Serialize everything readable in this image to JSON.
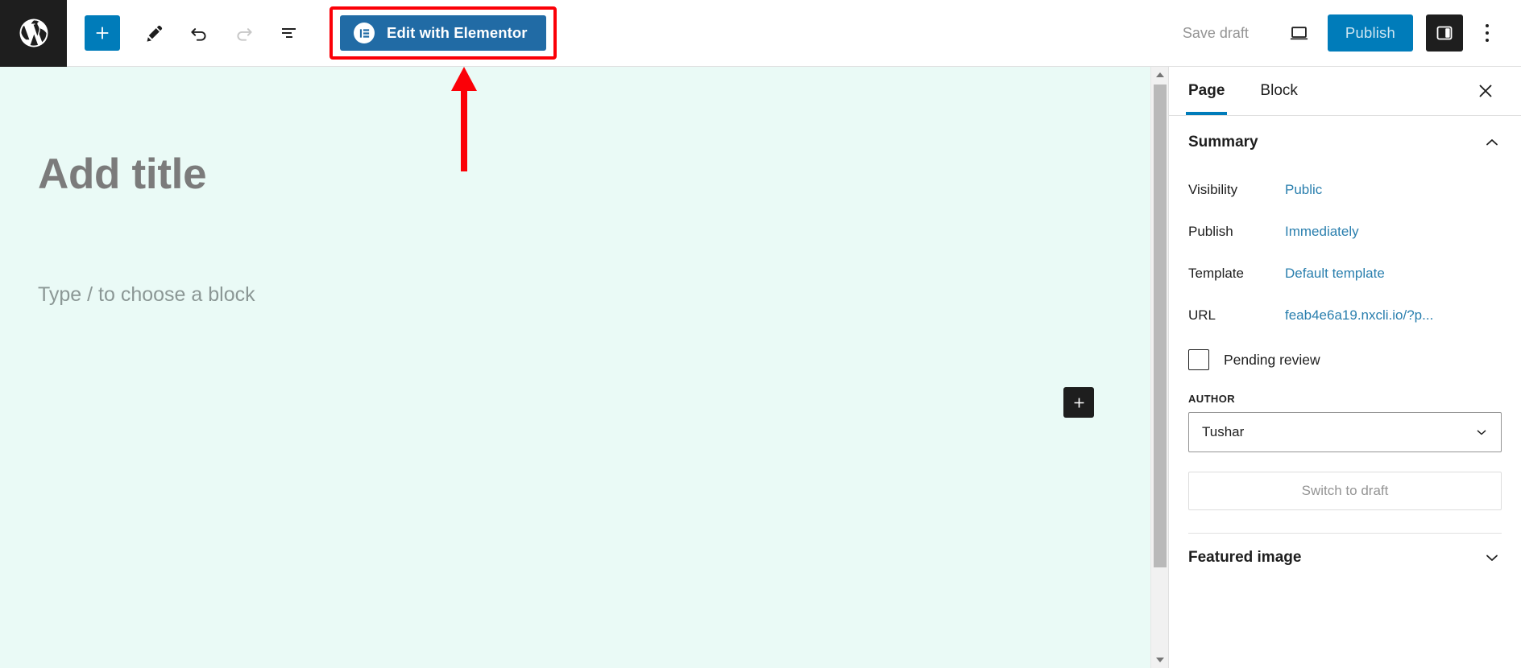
{
  "topbar": {
    "wp_logo_icon": "wordpress-logo-icon",
    "add_block_label": "+",
    "add_block_icon": "plus-icon",
    "tools_icon": "pencil-edit-icon",
    "undo_icon": "undo-arrow-icon",
    "redo_icon": "redo-arrow-icon",
    "list_view_icon": "list-view-icon",
    "elementor_label": "Edit with Elementor",
    "elementor_icon": "elementor-logo-icon",
    "save_draft_label": "Save draft",
    "preview_icon": "desktop-preview-icon",
    "publish_label": "Publish",
    "settings_icon": "settings-sidebar-icon",
    "more_icon": "vertical-dots-icon"
  },
  "canvas": {
    "title_placeholder": "Add title",
    "block_placeholder": "Type / to choose a block",
    "inserter_icon": "plus-icon",
    "background_color": "#eafaf6"
  },
  "annotation": {
    "highlight_color": "#fb0007",
    "arrow_icon": "up-arrow-annotation",
    "target": "Edit with Elementor"
  },
  "sidebar": {
    "tabs": [
      {
        "label": "Page",
        "active": true
      },
      {
        "label": "Block",
        "active": false
      }
    ],
    "close_icon": "close-icon",
    "summary": {
      "title": "Summary",
      "collapse_icon": "chevron-up-icon",
      "rows": [
        {
          "label": "Visibility",
          "value": "Public"
        },
        {
          "label": "Publish",
          "value": "Immediately"
        },
        {
          "label": "Template",
          "value": "Default template"
        },
        {
          "label": "URL",
          "value": "feab4e6a19.nxcli.io/?p..."
        }
      ],
      "pending_review_label": "Pending review",
      "pending_review_checked": false,
      "author_label": "AUTHOR",
      "author_value": "Tushar",
      "author_chevron_icon": "chevron-down-icon",
      "switch_to_draft_label": "Switch to draft"
    },
    "featured_image": {
      "title": "Featured image",
      "expand_icon": "chevron-down-icon"
    },
    "link_color": "#2a7fae"
  },
  "scrollbar": {
    "up_icon": "triangle-up-icon",
    "down_icon": "triangle-down-icon"
  }
}
